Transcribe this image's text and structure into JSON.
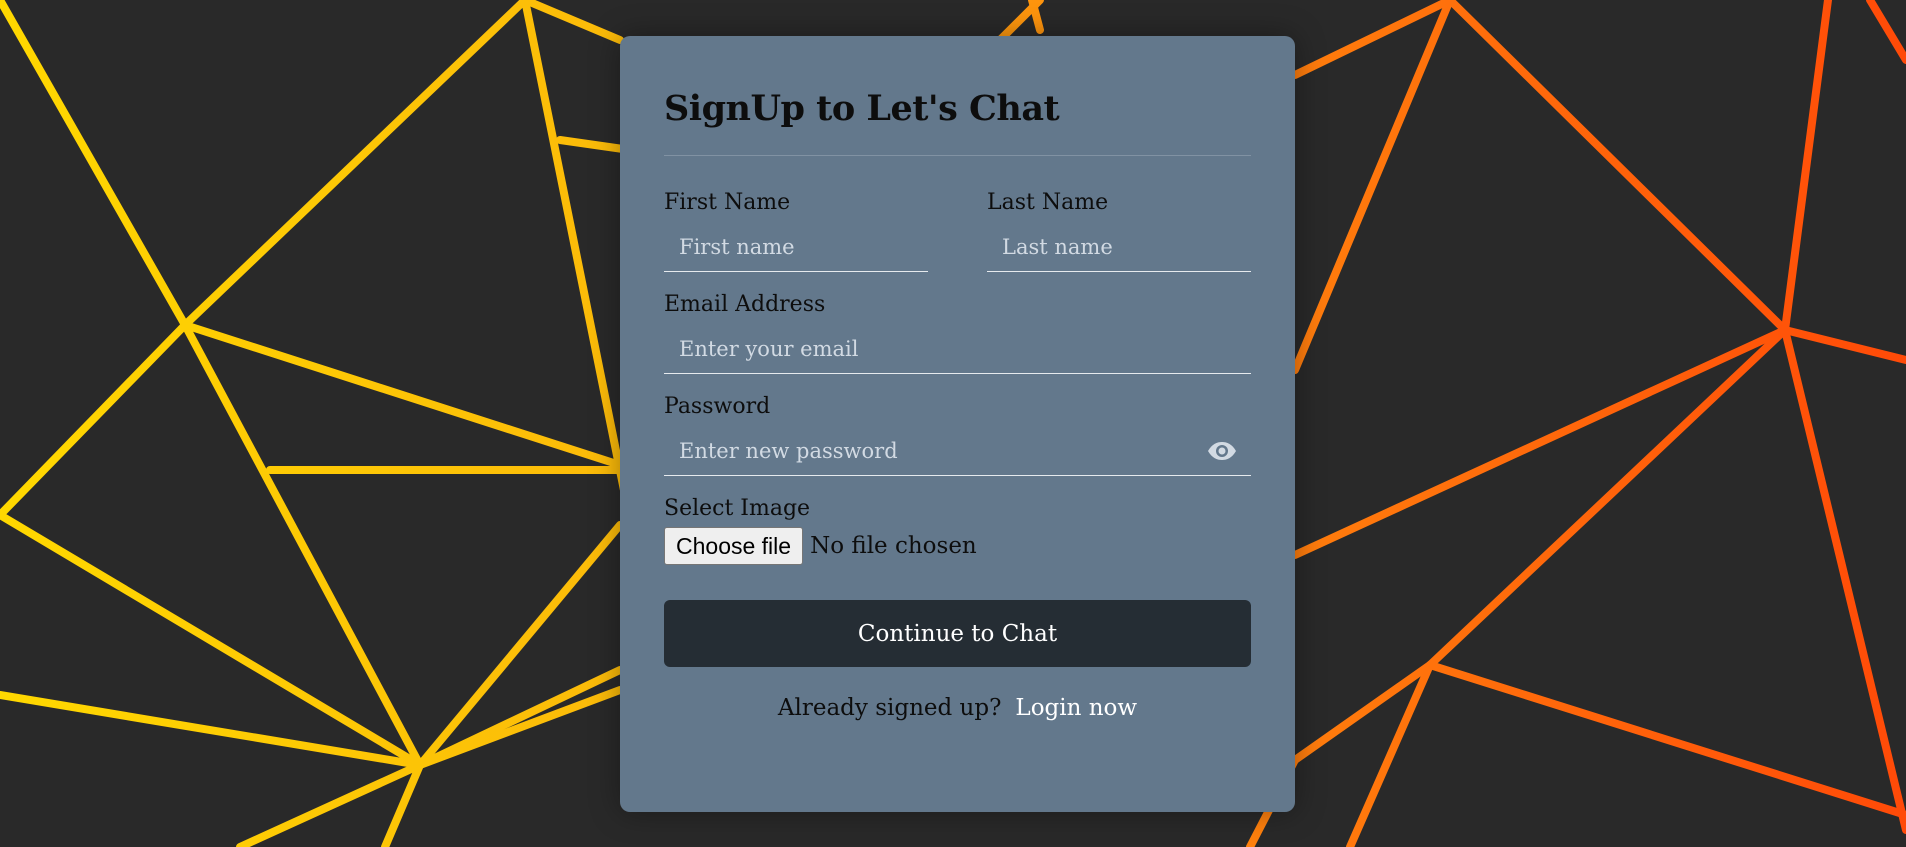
{
  "form": {
    "title": "SignUp to Let's Chat",
    "first_name": {
      "label": "First Name",
      "placeholder": "First name",
      "value": ""
    },
    "last_name": {
      "label": "Last Name",
      "placeholder": "Last name",
      "value": ""
    },
    "email": {
      "label": "Email Address",
      "placeholder": "Enter your email",
      "value": ""
    },
    "password": {
      "label": "Password",
      "placeholder": "Enter new password",
      "value": "",
      "toggle_icon": "eye-icon"
    },
    "image": {
      "label": "Select Image",
      "button_label": "Choose file",
      "status": "No file chosen"
    },
    "submit_label": "Continue to Chat",
    "footer": {
      "prompt": "Already signed up?",
      "link_label": "Login now"
    }
  },
  "colors": {
    "background": "#292929",
    "card": "#63788c",
    "button": "#252d34",
    "line_yellow": "#ffd600",
    "line_orange": "#ff4c0a"
  }
}
